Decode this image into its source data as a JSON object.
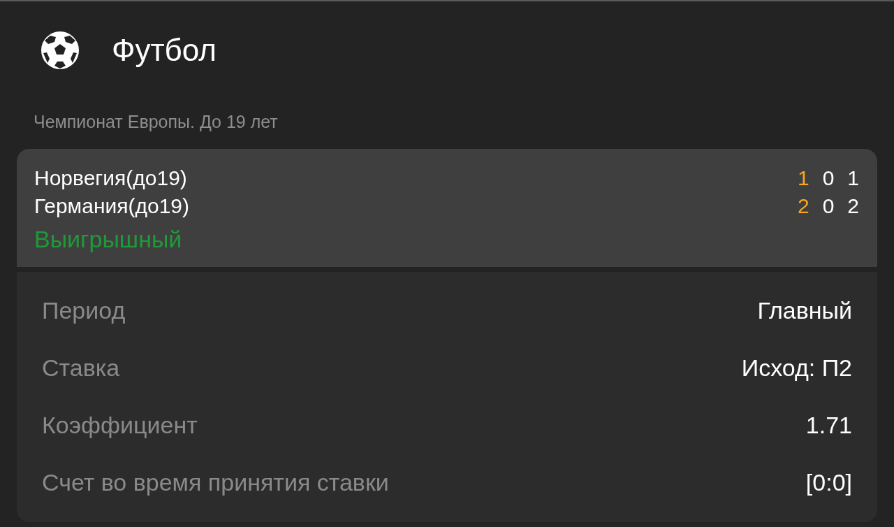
{
  "header": {
    "title": "Футбол"
  },
  "tournament": "Чемпионат Европы. До 19 лет",
  "match": {
    "teams": [
      {
        "name": "Норвегия(до19)",
        "scores": [
          {
            "value": "1",
            "highlighted": true
          },
          {
            "value": "0",
            "highlighted": false
          },
          {
            "value": "1",
            "highlighted": false
          }
        ]
      },
      {
        "name": "Германия(до19)",
        "scores": [
          {
            "value": "2",
            "highlighted": true
          },
          {
            "value": "0",
            "highlighted": false
          },
          {
            "value": "2",
            "highlighted": false
          }
        ]
      }
    ],
    "status": {
      "label": "Выигрышный",
      "kind": "won"
    }
  },
  "details": [
    {
      "label": "Период",
      "value": "Главный"
    },
    {
      "label": "Ставка",
      "value": "Исход: П2"
    },
    {
      "label": "Коэффициент",
      "value": "1.71"
    },
    {
      "label": "Счет во время принятия ставки",
      "value": "[0:0]"
    }
  ]
}
